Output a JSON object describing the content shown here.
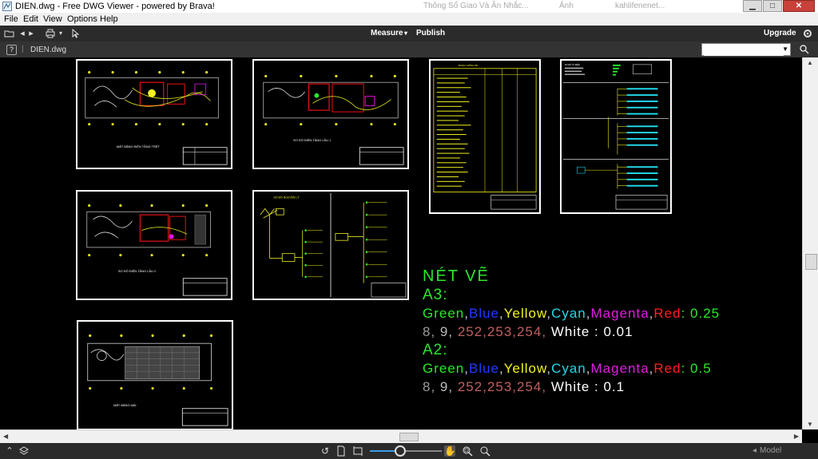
{
  "window": {
    "title": "DIEN.dwg - Free DWG Viewer - powered by Brava!",
    "background_tabs": [
      "Thông Sổ Giao Và Ăn Nhắc...",
      "Ảnh",
      "kahlifenenet..."
    ],
    "minimize": "▁",
    "maximize": "□",
    "close": "✕"
  },
  "menu": {
    "items": [
      "File",
      "Edit",
      "View",
      "Options",
      "Help"
    ]
  },
  "toolbar": {
    "measure": "Measure",
    "measure_arrow": "▾",
    "publish": "Publish",
    "upgrade": "Upgrade"
  },
  "docbar": {
    "help": "?",
    "separator": "|",
    "file_name": "DIEN.dwg",
    "search_value": "",
    "search_placeholder": ""
  },
  "icons": {
    "open": "folder-open-icon",
    "back": "back-arrow-icon",
    "forward": "forward-arrow-icon",
    "print": "print-icon",
    "select": "cursor-icon",
    "help": "help-icon",
    "search": "magnifier-icon",
    "layers": "layers-icon",
    "rotate": "rotate-icon",
    "page": "page-icon",
    "fit": "fit-icon",
    "pan": "pan-hand-icon",
    "zoom_window": "zoom-window-icon",
    "zoom": "zoom-icon"
  },
  "status": {
    "model_label": "Model",
    "zoom_level": 0.42
  },
  "legend": {
    "title": "NÉT VẼ",
    "a3_label": "A3:",
    "a2_label": "A2:",
    "colors": [
      {
        "name": "Green",
        "hex": "#2ce62c"
      },
      {
        "name": "Blue",
        "hex": "#1e3cff"
      },
      {
        "name": "Yellow",
        "hex": "#f4f420"
      },
      {
        "name": "Cyan",
        "hex": "#22d8e8"
      },
      {
        "name": "Magenta",
        "hex": "#e01ee0"
      },
      {
        "name": "Red",
        "hex": "#ff2020"
      }
    ],
    "a3_weight": ": 0.25",
    "a2_weight": ": 0.5",
    "gray_8": "8",
    "gray_9": "9",
    "gray_set": "252,253,254",
    "white": "White",
    "a3_white_weight": " : 0.01",
    "a2_white_weight": " : 0.1"
  },
  "sheets": [
    {
      "label": "MẶT BẰNG ĐIỆN TẦNG TRỆT"
    },
    {
      "label": "SƠ ĐỒ ĐIỆN TẦNG LẦU 1"
    },
    {
      "label": "SƠ ĐỒ ĐIỆN TẦNG LẦU 2"
    },
    {
      "label": "SƠ ĐỒ NGUYÊN LÝ"
    },
    {
      "label": "MẶT BẰNG MÁI"
    },
    {
      "label": "BẢNG THỐNG KÊ"
    },
    {
      "label": "SƠ ĐỒ TỦ ĐIỆN"
    }
  ]
}
